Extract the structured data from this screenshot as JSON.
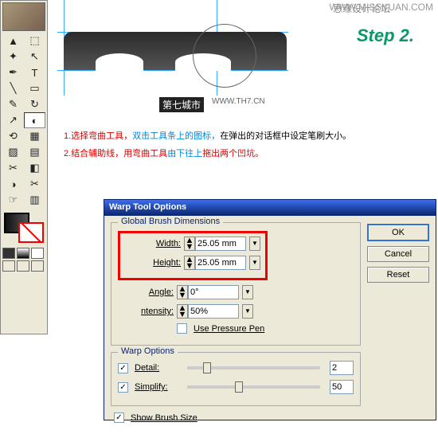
{
  "watermark": {
    "site": "WWW.MISSYUAN.COM",
    "forum": "思缘设计论坛"
  },
  "step_label": "Step 2.",
  "caption": {
    "text": "第七城市",
    "url": "WWW.TH7.CN"
  },
  "instructions": {
    "line1_num": "1.",
    "line1a": "选择弯曲工具，",
    "line1b": "双击工具条上的图标，",
    "line1c": "在弹出的对话框中设定笔刷大小。",
    "line2_num": "2.",
    "line2a": "结合辅助线，用弯曲工具",
    "line2b": "由下往上",
    "line2c": "拖出两个凹坑。"
  },
  "dialog": {
    "title": "Warp Tool Options",
    "group1": "Global Brush Dimensions",
    "width_label": "Width:",
    "width_value": "25.05 mm",
    "height_label": "Height:",
    "height_value": "25.05 mm",
    "angle_label": "Angle:",
    "angle_value": "0°",
    "intensity_label": "ntensity:",
    "intensity_value": "50%",
    "pressure": "Use Pressure Pen",
    "group2": "Warp Options",
    "detail_label": "Detail:",
    "detail_value": "2",
    "simplify_label": "Simplify:",
    "simplify_value": "50",
    "show_brush": "Show Brush Size",
    "ok": "OK",
    "cancel": "Cancel",
    "reset": "Reset"
  },
  "tools": {
    "r1a": "▲",
    "r1b": "⬚",
    "r2a": "✦",
    "r2b": "↖",
    "r3a": "✒",
    "r3b": "T",
    "r4a": "╲",
    "r4b": "▭",
    "r5a": "✎",
    "r5b": "↻",
    "r6a": "↗",
    "r6b": "◐",
    "r7a": "⟲",
    "r7b": "▦",
    "r8a": "▨",
    "r8b": "▤",
    "r9a": "✂",
    "r9b": "◧",
    "r10a": "◑",
    "r10b": "✂",
    "r11a": "☞",
    "r11b": "▥"
  }
}
